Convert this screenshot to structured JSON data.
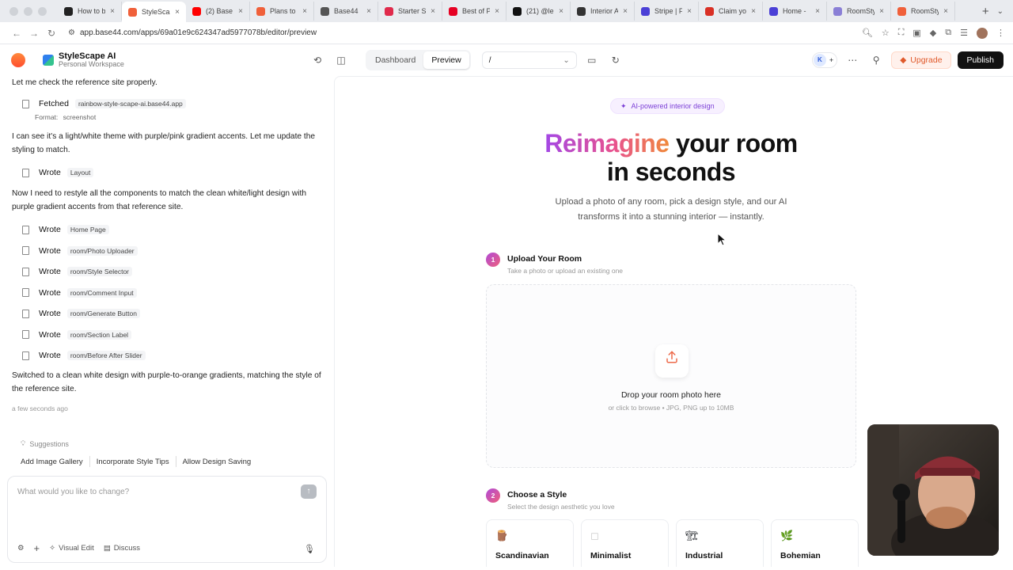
{
  "browser": {
    "tabs": [
      {
        "label": "How to b",
        "color": "#222222",
        "active": false
      },
      {
        "label": "StyleSca",
        "color": "#f0603a",
        "active": true
      },
      {
        "label": "(2) Base",
        "color": "#ff0000",
        "active": false
      },
      {
        "label": "Plans to",
        "color": "#f0603a",
        "active": false
      },
      {
        "label": "Base44",
        "color": "#555555",
        "active": false
      },
      {
        "label": "Starter S",
        "color": "#e02a4b",
        "active": false
      },
      {
        "label": "Best of P",
        "color": "#e60023",
        "active": false
      },
      {
        "label": "(21) @le",
        "color": "#111111",
        "active": false
      },
      {
        "label": "Interior A",
        "color": "#333333",
        "active": false
      },
      {
        "label": "Stripe | F",
        "color": "#4a3fd6",
        "active": false
      },
      {
        "label": "Claim yo",
        "color": "#d93025",
        "active": false
      },
      {
        "label": "Home -",
        "color": "#4a3fd6",
        "active": false
      },
      {
        "label": "RoomSty",
        "color": "#8a7fd6",
        "active": false
      },
      {
        "label": "RoomSty",
        "color": "#f0603a",
        "active": false
      }
    ],
    "url": "app.base44.com/apps/69a01e9c624347ad5977078b/editor/preview"
  },
  "appbar": {
    "project_name": "StyleScape AI",
    "workspace": "Personal Workspace",
    "tab_dashboard": "Dashboard",
    "tab_preview": "Preview",
    "route": "/",
    "avatar_initial": "K",
    "upgrade_label": "Upgrade",
    "publish_label": "Publish"
  },
  "chat": {
    "msg1": "Let me check the reference site properly.",
    "fetched_verb": "Fetched",
    "fetched_chip": "rainbow-style-scape-ai.base44.app",
    "format_label": "Format:",
    "format_value": "screenshot",
    "msg2": "I can see it's a light/white theme with purple/pink gradient accents. Let me update the styling to match.",
    "layout_verb": "Wrote",
    "layout_chip": "Layout",
    "msg3": "Now I need to restyle all the components to match the clean white/light design with purple gradient accents from that reference site.",
    "writes": [
      {
        "verb": "Wrote",
        "chip": "Home Page"
      },
      {
        "verb": "Wrote",
        "chip": "room/Photo Uploader"
      },
      {
        "verb": "Wrote",
        "chip": "room/Style Selector"
      },
      {
        "verb": "Wrote",
        "chip": "room/Comment Input"
      },
      {
        "verb": "Wrote",
        "chip": "room/Generate Button"
      },
      {
        "verb": "Wrote",
        "chip": "room/Section Label"
      },
      {
        "verb": "Wrote",
        "chip": "room/Before After Slider"
      }
    ],
    "msg4": "Switched to a clean white design with purple-to-orange gradients, matching the style of the reference site.",
    "timestamp": "a few seconds ago",
    "suggestions_title": "Suggestions",
    "suggestions": [
      "Add Image Gallery",
      "Incorporate Style Tips",
      "Allow Design Saving"
    ],
    "input_placeholder": "What would you like to change?",
    "visual_edit": "Visual Edit",
    "discuss": "Discuss"
  },
  "preview": {
    "badge": "AI-powered interior design",
    "hero_gradient": "Reimagine",
    "hero_rest1": " your room",
    "hero_line2": "in seconds",
    "subtitle": "Upload a photo of any room, pick a design style, and our AI transforms it into a stunning interior — instantly.",
    "step1_num": "1",
    "step1_title": "Upload Your Room",
    "step1_desc": "Take a photo or upload an existing one",
    "drop_title": "Drop your room photo here",
    "drop_hint": "or click to browse • JPG, PNG up to 10MB",
    "step2_num": "2",
    "step2_title": "Choose a Style",
    "step2_desc": "Select the design aesthetic you love",
    "styles": [
      {
        "emoji": "🪵",
        "name": "Scandinavian"
      },
      {
        "emoji": "◻",
        "name": "Minimalist"
      },
      {
        "emoji": "🏗",
        "name": "Industrial"
      },
      {
        "emoji": "🌿",
        "name": "Bohemian"
      }
    ]
  },
  "colors": {
    "accent_purple": "#a347e6",
    "accent_pink": "#e8528f",
    "accent_orange": "#f08a3a",
    "publish_bg": "#111111",
    "upgrade_text": "#e05a2b"
  }
}
